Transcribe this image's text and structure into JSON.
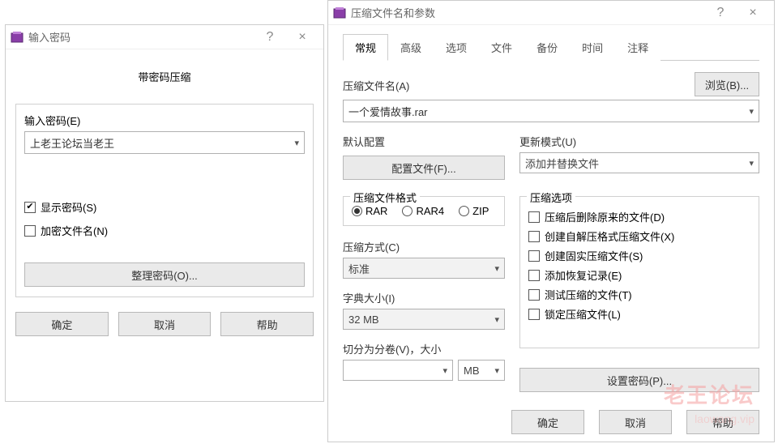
{
  "password_dialog": {
    "title": "输入密码",
    "subtitle": "带密码压缩",
    "password_label": "输入密码(E)",
    "password_value": "上老王论坛当老王",
    "show_password_label": "显示密码(S)",
    "show_password_checked": true,
    "encrypt_filename_label": "加密文件名(N)",
    "encrypt_filename_checked": false,
    "manage_passwords_label": "整理密码(O)...",
    "ok_label": "确定",
    "cancel_label": "取消",
    "help_label": "帮助"
  },
  "archive_dialog": {
    "title": "压缩文件名和参数",
    "tabs": [
      "常规",
      "高级",
      "选项",
      "文件",
      "备份",
      "时间",
      "注释"
    ],
    "active_tab": 0,
    "archive_name_label": "压缩文件名(A)",
    "archive_name_value": "一个爱情故事.rar",
    "browse_label": "浏览(B)...",
    "default_profile_label": "默认配置",
    "profiles_button_label": "配置文件(F)...",
    "update_mode_label": "更新模式(U)",
    "update_mode_value": "添加并替换文件",
    "format_legend": "压缩文件格式",
    "format_options": [
      "RAR",
      "RAR4",
      "ZIP"
    ],
    "format_selected": 0,
    "options_legend": "压缩选项",
    "options": [
      "压缩后删除原来的文件(D)",
      "创建自解压格式压缩文件(X)",
      "创建固实压缩文件(S)",
      "添加恢复记录(E)",
      "测试压缩的文件(T)",
      "锁定压缩文件(L)"
    ],
    "method_label": "压缩方式(C)",
    "method_value": "标准",
    "dict_label": "字典大小(I)",
    "dict_value": "32 MB",
    "split_label": "切分为分卷(V)，大小",
    "split_value": "",
    "split_unit": "MB",
    "set_password_label": "设置密码(P)...",
    "ok_label": "确定",
    "cancel_label": "取消",
    "help_label": "帮助"
  },
  "watermark": {
    "main": "老王论坛",
    "sub": "laowang.vip"
  }
}
